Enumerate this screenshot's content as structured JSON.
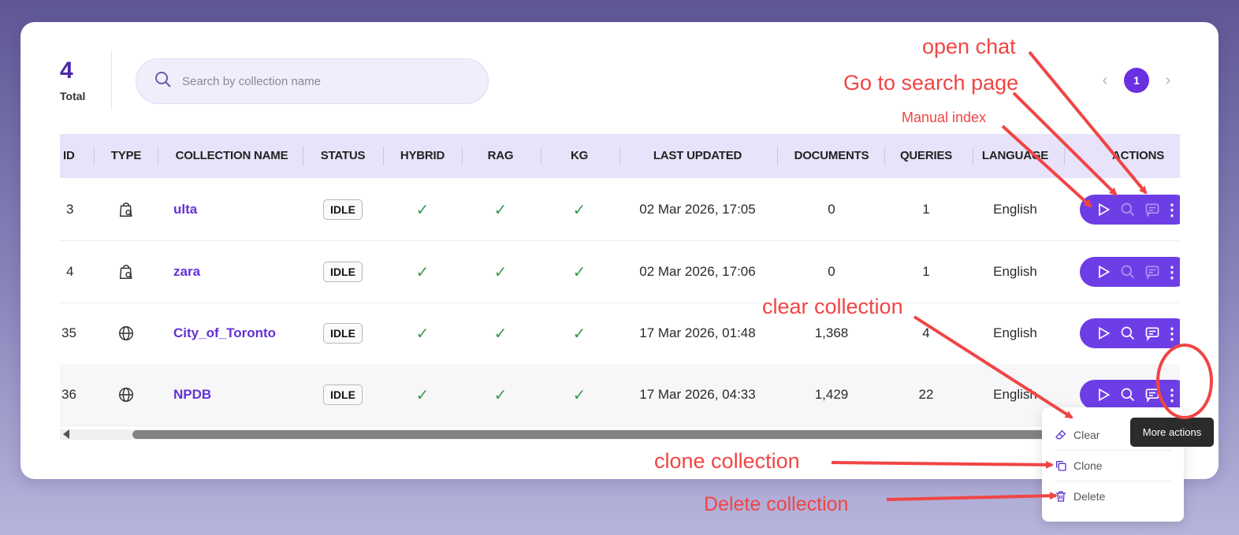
{
  "summary": {
    "total_count": "4",
    "total_label": "Total"
  },
  "search": {
    "placeholder": "Search by collection name",
    "value": ""
  },
  "pagination": {
    "prev": "‹",
    "current_page": "1",
    "next": "›"
  },
  "table": {
    "headers": {
      "id": "ID",
      "type": "TYPE",
      "name": "COLLECTION NAME",
      "status": "STATUS",
      "hybrid": "HYBRID",
      "rag": "RAG",
      "kg": "KG",
      "last_updated": "LAST UPDATED",
      "documents": "DOCUMENTS",
      "queries": "QUERIES",
      "language": "LANGUAGE",
      "actions": "ACTIONS"
    },
    "rows": [
      {
        "id": "3",
        "type_icon": "shopping-bag-search-icon",
        "name": "ulta",
        "status": "IDLE",
        "hybrid": "✓",
        "rag": "✓",
        "kg": "✓",
        "last_updated": "02 Mar 2026, 17:05",
        "documents": "0",
        "queries": "1",
        "language": "English"
      },
      {
        "id": "4",
        "type_icon": "shopping-bag-search-icon",
        "name": "zara",
        "status": "IDLE",
        "hybrid": "✓",
        "rag": "✓",
        "kg": "✓",
        "last_updated": "02 Mar 2026, 17:06",
        "documents": "0",
        "queries": "1",
        "language": "English"
      },
      {
        "id": "35",
        "type_icon": "globe-icon",
        "name": "City_of_Toronto",
        "status": "IDLE",
        "hybrid": "✓",
        "rag": "✓",
        "kg": "✓",
        "last_updated": "17 Mar 2026, 01:48",
        "documents": "1,368",
        "queries": "4",
        "language": "English"
      },
      {
        "id": "36",
        "type_icon": "globe-icon",
        "name": "NPDB",
        "status": "IDLE",
        "hybrid": "✓",
        "rag": "✓",
        "kg": "✓",
        "last_updated": "17 Mar 2026, 04:33",
        "documents": "1,429",
        "queries": "22",
        "language": "English"
      }
    ]
  },
  "menu": {
    "clear": "Clear",
    "clone": "Clone",
    "delete": "Delete"
  },
  "tooltip": "More actions",
  "annotations": {
    "open_chat": "open chat",
    "go_to_search": "Go to search page",
    "manual_index": "Manual index",
    "clear_collection": "clear collection",
    "clone_collection": "clone collection",
    "delete_collection": "Delete collection"
  },
  "colors": {
    "accent": "#6d3ee6",
    "annotation": "#f04545",
    "check": "#3a9a4f"
  }
}
